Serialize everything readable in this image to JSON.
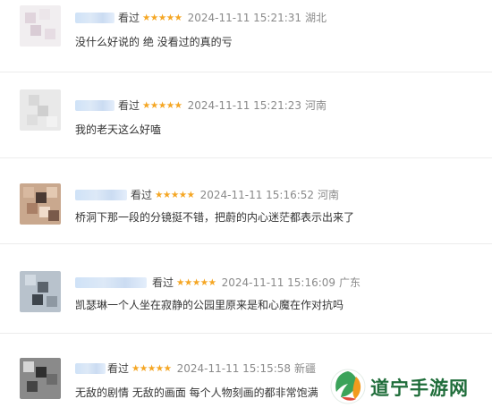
{
  "reviews": [
    {
      "rating_label": "看过",
      "stars": "★★★★★",
      "time": "2024-11-11 15:21:31",
      "location": "湖北",
      "content": "没什么好说的 绝 没看过的真的亏"
    },
    {
      "rating_label": "看过",
      "stars": "★★★★★",
      "time": "2024-11-11 15:21:23",
      "location": "河南",
      "content": "我的老天这么好嗑"
    },
    {
      "rating_label": "看过",
      "stars": "★★★★★",
      "time": "2024-11-11 15:16:52",
      "location": "河南",
      "content": "桥洞下那一段的分镜挺不错，把蔚的内心迷茫都表示出来了"
    },
    {
      "rating_label": "看过",
      "stars": "★★★★★",
      "time": "2024-11-11 15:16:09",
      "location": "广东",
      "content": "凯瑟琳一个人坐在寂静的公园里原来是和心魔在作对抗吗"
    },
    {
      "rating_label": "看过",
      "stars": "★★★★★",
      "time": "2024-11-11 15:15:58",
      "location": "新疆",
      "content": "无敌的剧情 无敌的画面 每个人物刻画的都非常饱满"
    }
  ],
  "watermark": {
    "text": "道宁手游网"
  },
  "colors": {
    "star": "#f5a623",
    "time": "#8a8a8a",
    "watermark_green": "#1f6d3a"
  }
}
